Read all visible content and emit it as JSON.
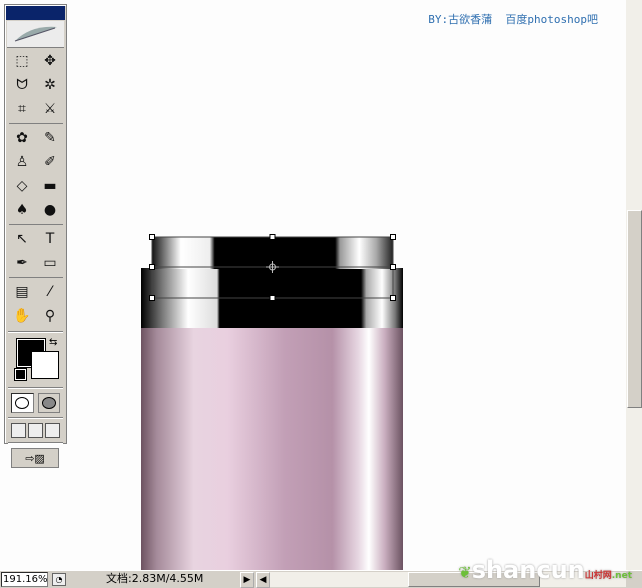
{
  "credit_text": "BY:古欲香蒲  百度photoshop吧",
  "toolbox": {
    "tools": [
      {
        "name": "marquee-tool",
        "glyph": "⬚"
      },
      {
        "name": "move-tool",
        "glyph": "✥"
      },
      {
        "name": "lasso-tool",
        "glyph": "ᗢ"
      },
      {
        "name": "magic-wand-tool",
        "glyph": "✲"
      },
      {
        "name": "crop-tool",
        "glyph": "⌗"
      },
      {
        "name": "slice-tool",
        "glyph": "⚔"
      },
      {
        "name": "healing-brush-tool",
        "glyph": "✿"
      },
      {
        "name": "brush-tool",
        "glyph": "✎"
      },
      {
        "name": "clone-stamp-tool",
        "glyph": "♙"
      },
      {
        "name": "history-brush-tool",
        "glyph": "✐"
      },
      {
        "name": "eraser-tool",
        "glyph": "◇"
      },
      {
        "name": "gradient-tool",
        "glyph": "▬"
      },
      {
        "name": "blur-tool",
        "glyph": "♠"
      },
      {
        "name": "dodge-tool",
        "glyph": "●"
      },
      {
        "name": "path-selection-tool",
        "glyph": "↖"
      },
      {
        "name": "type-tool",
        "glyph": "T"
      },
      {
        "name": "pen-tool",
        "glyph": "✒"
      },
      {
        "name": "shape-tool",
        "glyph": "▭"
      },
      {
        "name": "notes-tool",
        "glyph": "▤"
      },
      {
        "name": "eyedropper-tool",
        "glyph": "⁄"
      },
      {
        "name": "hand-tool",
        "glyph": "✋"
      },
      {
        "name": "zoom-tool",
        "glyph": "⚲"
      }
    ]
  },
  "colors": {
    "foreground": "#000000",
    "background": "#ffffff",
    "accent": "#2f6fb0"
  },
  "status": {
    "zoom": "191.16%",
    "doc_size": "文档:2.83M/4.55M"
  },
  "watermark": {
    "text": "shancun",
    "sub": "山村网",
    "domain": ".net"
  }
}
